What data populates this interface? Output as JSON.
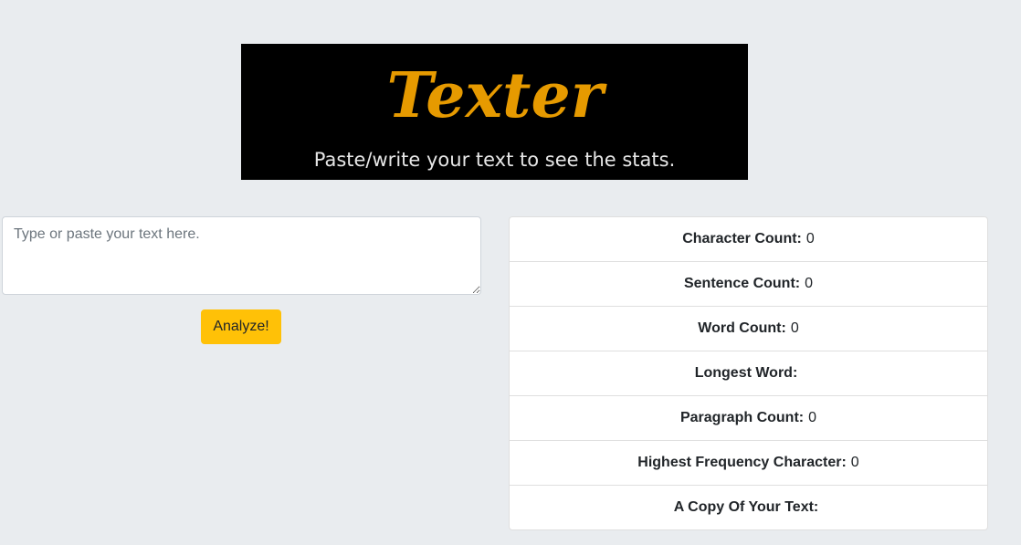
{
  "header": {
    "logo_text": "Texter",
    "logo_color": "#e69a00",
    "tagline": "Paste/write your text to see the stats."
  },
  "input": {
    "placeholder": "Type or paste your text here.",
    "value": ""
  },
  "analyze_button": {
    "label": "Analyze!",
    "color": "#ffc107"
  },
  "stats": {
    "items": [
      {
        "label": "Character Count:",
        "value": "0"
      },
      {
        "label": "Sentence Count:",
        "value": "0"
      },
      {
        "label": "Word Count:",
        "value": "0"
      },
      {
        "label": "Longest Word:",
        "value": ""
      },
      {
        "label": "Paragraph Count:",
        "value": "0"
      },
      {
        "label": "Highest Frequency Character:",
        "value": "0"
      },
      {
        "label": "A Copy Of Your Text:",
        "value": ""
      }
    ]
  }
}
